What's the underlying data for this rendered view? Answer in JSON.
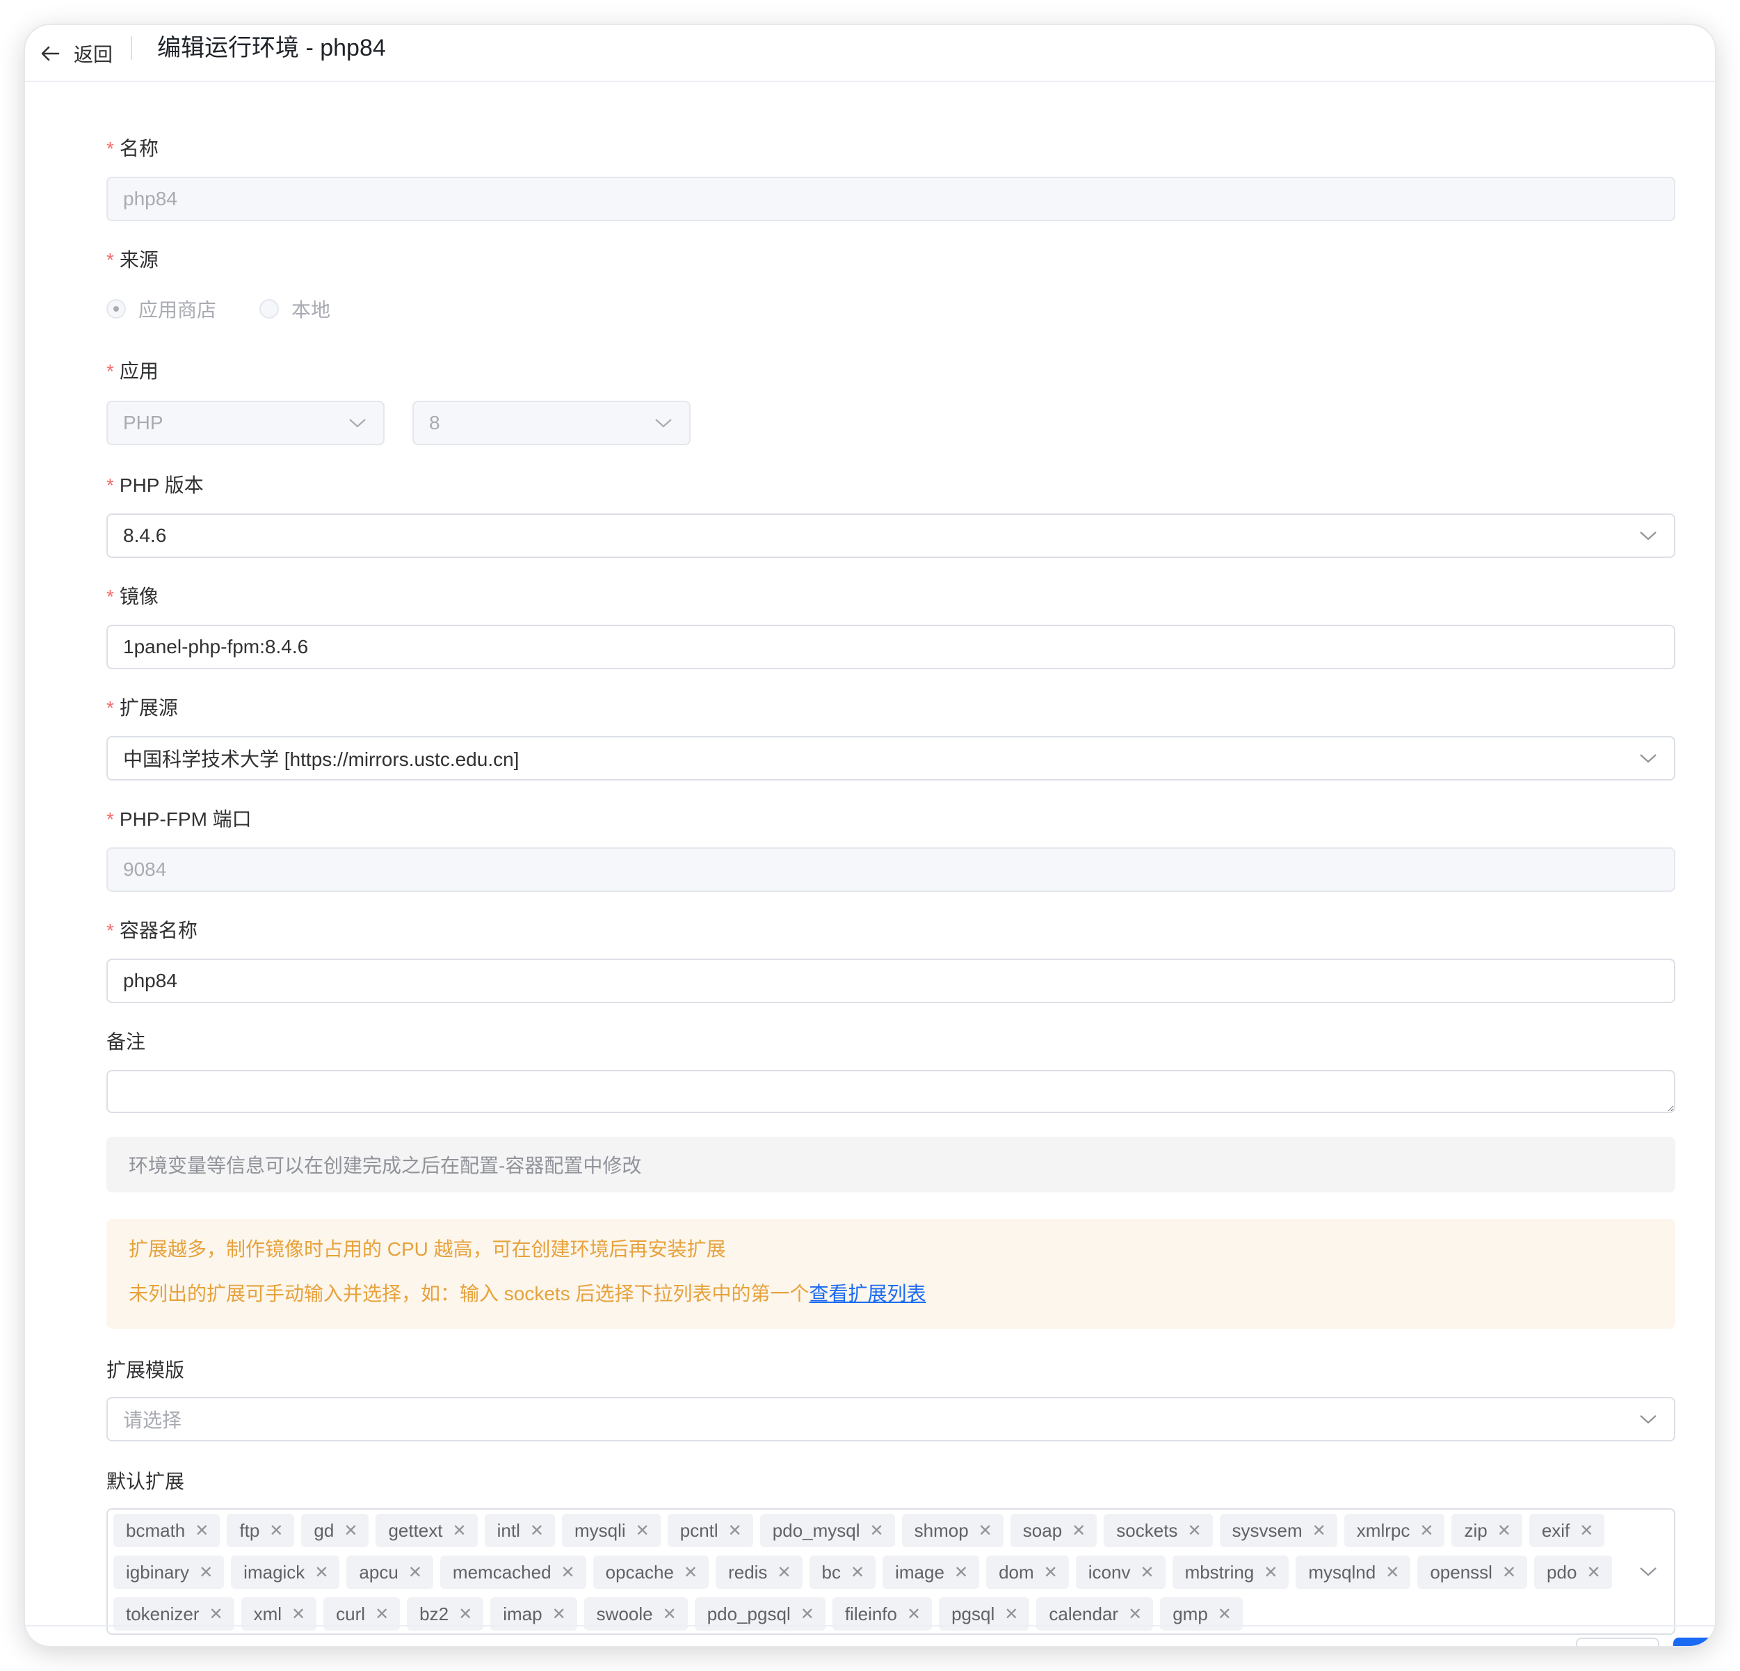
{
  "header": {
    "back_label": "返回",
    "title": "编辑运行环境 - php84"
  },
  "form": {
    "name": {
      "label": "名称",
      "value": "php84"
    },
    "source": {
      "label": "来源",
      "options": [
        "应用商店",
        "本地"
      ],
      "selected": "应用商店"
    },
    "app": {
      "label": "应用",
      "app_value": "PHP",
      "version_value": "8"
    },
    "php_version": {
      "label": "PHP 版本",
      "value": "8.4.6"
    },
    "image": {
      "label": "镜像",
      "value": "1panel-php-fpm:8.4.6"
    },
    "ext_source": {
      "label": "扩展源",
      "value": "中国科学技术大学 [https://mirrors.ustc.edu.cn]"
    },
    "fpm_port": {
      "label": "PHP-FPM 端口",
      "value": "9084"
    },
    "container_name": {
      "label": "容器名称",
      "value": "php84"
    },
    "remark": {
      "label": "备注",
      "value": ""
    },
    "info_text": "环境变量等信息可以在创建完成之后在配置-容器配置中修改",
    "warning": {
      "line1": "扩展越多，制作镜像时占用的 CPU 越高，可在创建环境后再安装扩展",
      "line2": "未列出的扩展可手动输入并选择，如：输入 sockets 后选择下拉列表中的第一个",
      "link": "查看扩展列表"
    },
    "ext_template": {
      "label": "扩展模版",
      "placeholder": "请选择"
    },
    "default_ext": {
      "label": "默认扩展",
      "tags": [
        "bcmath",
        "ftp",
        "gd",
        "gettext",
        "intl",
        "mysqli",
        "pcntl",
        "pdo_mysql",
        "shmop",
        "soap",
        "sockets",
        "sysvsem",
        "xmlrpc",
        "zip",
        "exif",
        "igbinary",
        "imagick",
        "apcu",
        "memcached",
        "opcache",
        "redis",
        "bc",
        "image",
        "dom",
        "iconv",
        "mbstring",
        "mysqlnd",
        "openssl",
        "pdo",
        "tokenizer",
        "xml",
        "curl",
        "bz2",
        "imap",
        "swoole",
        "pdo_pgsql",
        "fileinfo",
        "pgsql",
        "calendar",
        "gmp"
      ]
    }
  },
  "colors": {
    "required": "#f56c6c",
    "warning": "#e6a23c",
    "link": "#1b6af3",
    "primary": "#1b6af3"
  }
}
